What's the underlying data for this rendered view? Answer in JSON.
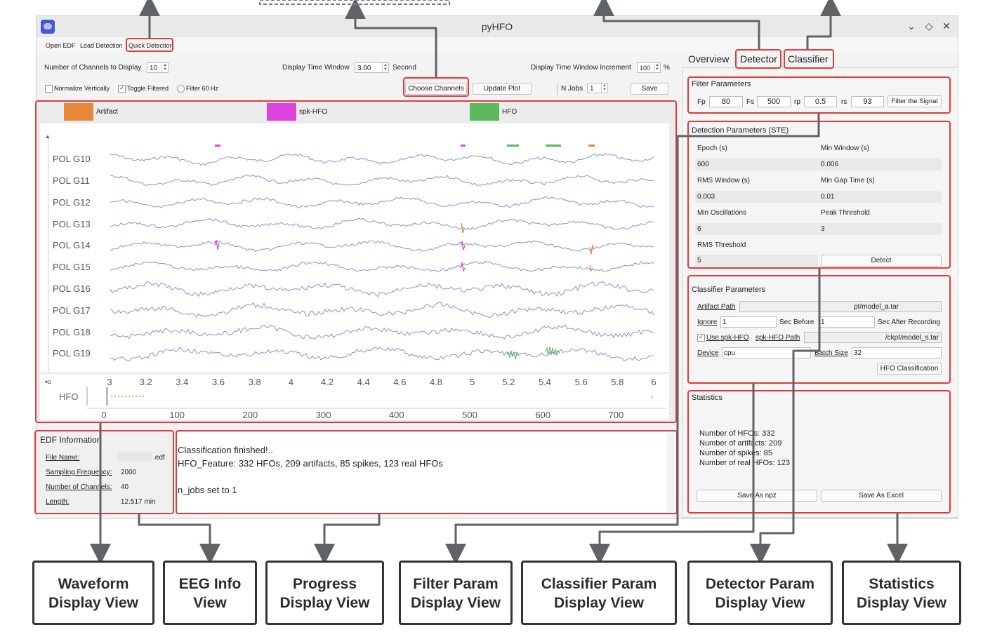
{
  "window": {
    "title": "pyHFO"
  },
  "menu": {
    "open_edf": "Open EDF",
    "load_detection": "Load Detection",
    "quick_detection": "Quick Detection"
  },
  "controls": {
    "num_channels_label": "Number of Channels to Display",
    "num_channels_value": "10",
    "time_window_label": "Display Time Window",
    "time_window_value": "3.00",
    "time_window_unit": "Second",
    "time_increment_label": "Display Time Window Increment",
    "time_increment_value": "100",
    "time_increment_unit": "%",
    "normalize_label": "Normalize Vertically",
    "toggle_filtered_label": "Toggle Filtered",
    "filter60_label": "Filter 60 Hz",
    "choose_channels": "Choose Channels",
    "update_plot": "Update Plot",
    "n_jobs_label": "N Jobs",
    "n_jobs_value": "1",
    "save": "Save"
  },
  "legend": [
    {
      "label": "Artifact",
      "color": "#e8863a"
    },
    {
      "label": "spk-HFO",
      "color": "#dd44dd"
    },
    {
      "label": "HFO",
      "color": "#5cb85c"
    }
  ],
  "waveform": {
    "channels": [
      "POL G10",
      "POL G11",
      "POL G12",
      "POL G13",
      "POL G14",
      "POL G15",
      "POL G16",
      "POL G17",
      "POL G18",
      "POL G19"
    ],
    "x_ticks": [
      "3",
      "3.2",
      "3.4",
      "3.6",
      "3.8",
      "4",
      "4.2",
      "4.4",
      "4.6",
      "4.8",
      "5",
      "5.2",
      "5.4",
      "5.6",
      "5.8",
      "6"
    ],
    "trace_color": "#8a8fd6",
    "overview_label": "HFO",
    "overview_ticks": [
      "0",
      "100",
      "200",
      "300",
      "400",
      "500",
      "600",
      "700"
    ]
  },
  "edf_info": {
    "title": "EDF Information",
    "file_name_label": "File Name:",
    "file_name_value": ".edf",
    "sampling_label": "Sampling Frequency:",
    "sampling_value": "2000",
    "channels_label": "Number of Channels:",
    "channels_value": "40",
    "length_label": "Length:",
    "length_value": "12.517 min"
  },
  "log": {
    "lines": [
      "Classification finished!..",
      "HFO_Feature: 332 HFOs, 209 artifacts, 85 spikes, 123 real HFOs",
      "",
      "n_jobs set to 1"
    ]
  },
  "tabs": {
    "overview": "Overview",
    "detector": "Detector",
    "classifier": "Classifier"
  },
  "filter": {
    "title": "Filter Parameters",
    "fp_label": "Fp",
    "fp_value": "80",
    "fs_label": "Fs",
    "fs_value": "500",
    "rp_label": "rp",
    "rp_value": "0.5",
    "rs_label": "rs",
    "rs_value": "93",
    "button": "Filter the Signal"
  },
  "detection": {
    "title": "Detection Parameters (STE)",
    "epoch_label": "Epoch (s)",
    "epoch_value": "600",
    "min_window_label": "Min Window (s)",
    "min_window_value": "0.006",
    "rms_window_label": "RMS Window (s)",
    "rms_window_value": "0.003",
    "min_gap_label": "Min Gap Time (s)",
    "min_gap_value": "0.01",
    "min_osc_label": "Min Oscillations",
    "min_osc_value": "6",
    "peak_threshold_label": "Peak Threshold",
    "peak_threshold_value": "3",
    "rms_threshold_label": "RMS Threshold",
    "rms_threshold_value": "5",
    "detect_button": "Detect"
  },
  "classifier": {
    "title": "Classifier Parameters",
    "artifact_path_label": "Artifact Path",
    "artifact_path_value": "pt/model_a.tar",
    "ignore_label": "Ignore",
    "ignore_value": "1",
    "sec_before_label": "Sec Before",
    "sec_before_value": "1",
    "sec_after_label": "Sec After Recording",
    "use_spk_label": "Use spk-HFO",
    "spk_path_label": "spk-HFO Path",
    "spk_path_value": "/ckpt/model_s.tar",
    "device_label": "Device",
    "device_value": "cpu",
    "batch_label": "Batch Size",
    "batch_value": "32",
    "button": "HFO Classification"
  },
  "statistics": {
    "title": "Statistics",
    "lines": [
      "Number of HFOs: 332",
      "Number of artifacts: 209",
      "Number of spikes: 85",
      "Number of real HFOs: 123"
    ],
    "save_npz": "Save As npz",
    "save_excel": "Save As Excel"
  },
  "annotations": [
    {
      "line1": "Waveform",
      "line2": "Display View"
    },
    {
      "line1": "EEG Info",
      "line2": "View"
    },
    {
      "line1": "Progress",
      "line2": "Display View"
    },
    {
      "line1": "Filter Param",
      "line2": "Display View"
    },
    {
      "line1": "Classifier Param",
      "line2": "Display View"
    },
    {
      "line1": "Detector Param",
      "line2": "Display View"
    },
    {
      "line1": "Statistics",
      "line2": "Display View"
    }
  ]
}
